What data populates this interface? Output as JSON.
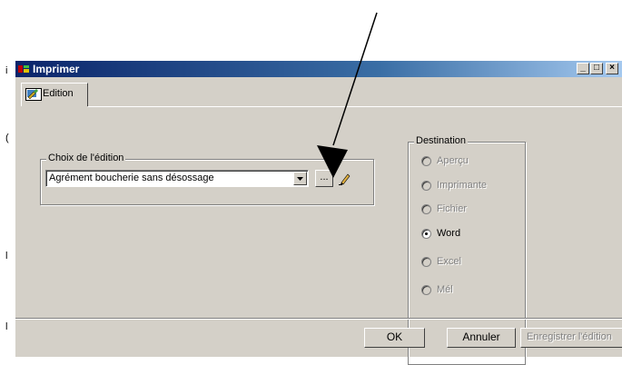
{
  "window": {
    "title": "Imprimer",
    "controls": {
      "minimize": "_",
      "maximize": "□",
      "close": "×"
    }
  },
  "tab": {
    "label": "Edition"
  },
  "edition_group": {
    "legend": "Choix de l'édition",
    "selected_value": "Agrément boucherie sans désossage",
    "browse_label": "..."
  },
  "destination": {
    "legend": "Destination",
    "options": [
      {
        "label": "Aperçu",
        "enabled": false,
        "checked": false
      },
      {
        "label": "Imprimante",
        "enabled": false,
        "checked": false
      },
      {
        "label": "Fichier",
        "enabled": false,
        "checked": false
      },
      {
        "label": "Word",
        "enabled": true,
        "checked": true
      },
      {
        "label": "Excel",
        "enabled": false,
        "checked": false
      },
      {
        "label": "Mél",
        "enabled": false,
        "checked": false
      }
    ]
  },
  "buttons": {
    "ok": "OK",
    "cancel": "Annuler",
    "save": "Enregistrer l'édition"
  },
  "colors": {
    "dialog_bg": "#d4d0c8",
    "titlebar_start": "#0a246a",
    "titlebar_end": "#a6caf0",
    "disabled_text": "#808080"
  }
}
